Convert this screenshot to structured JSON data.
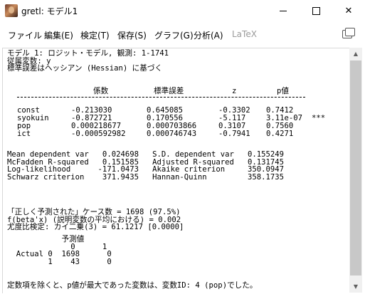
{
  "window": {
    "title": "gretl: モデル1",
    "minimize": "—",
    "maximize": "☐",
    "close": "✕"
  },
  "menu": [
    {
      "label": "ファイル",
      "disabled": false
    },
    {
      "label": "編集(E)",
      "disabled": false
    },
    {
      "label": "検定(T)",
      "disabled": false
    },
    {
      "label": "保存(S)",
      "disabled": false
    },
    {
      "label": "グラフ(G)",
      "disabled": false
    },
    {
      "label": "分析(A)",
      "disabled": false
    },
    {
      "label": "LaTeX",
      "disabled": true
    }
  ],
  "output": {
    "header": [
      "モデル 1: ロジット・モデル, 観測: 1-1741",
      "従属変数: y",
      "標準誤差はヘッシアン (Hessian) に基づく"
    ],
    "table_headers": [
      "係数",
      "標準誤差",
      "z",
      "p値"
    ],
    "rows": [
      {
        "name": "const",
        "coef": "-0.213030",
        "se": "0.645085",
        "z": "-0.3302",
        "p": "0.7412",
        "stars": ""
      },
      {
        "name": "syokuin",
        "coef": "-0.872721",
        "se": "0.170556",
        "z": "-5.117",
        "p": "3.11e-07",
        "stars": "***"
      },
      {
        "name": "pop",
        "coef": "0.000218677",
        "se": "0.000703866",
        "z": "0.3107",
        "p": "0.7560",
        "stars": ""
      },
      {
        "name": "ict",
        "coef": "-0.000592982",
        "se": "0.000746743",
        "z": "-0.7941",
        "p": "0.4271",
        "stars": ""
      }
    ],
    "stats": [
      "Mean dependent var   0.024698   S.D. dependent var   0.155249",
      "McFadden R-squared   0.151585   Adjusted R-squared   0.131745",
      "Log-likelihood      -171.0473   Akaike criterion     350.0947",
      "Schwarz criterion    371.9435   Hannan-Quinn         358.1735"
    ],
    "prediction": [
      "「正しく予測された」ケース数 = 1698 (97.5%)",
      "f(beta'x) (説明変数の平均における) = 0.002",
      "尤度比検定: カイ二乗(3) = 61.1217 [0.0000]"
    ],
    "confusion": [
      "            予測値",
      "              0      1",
      "  Actual 0  1698      0",
      "         1    43      0"
    ],
    "footer": "定数項を除くと、p値が最大であった変数は、変数ID: 4 (pop)でした。"
  }
}
